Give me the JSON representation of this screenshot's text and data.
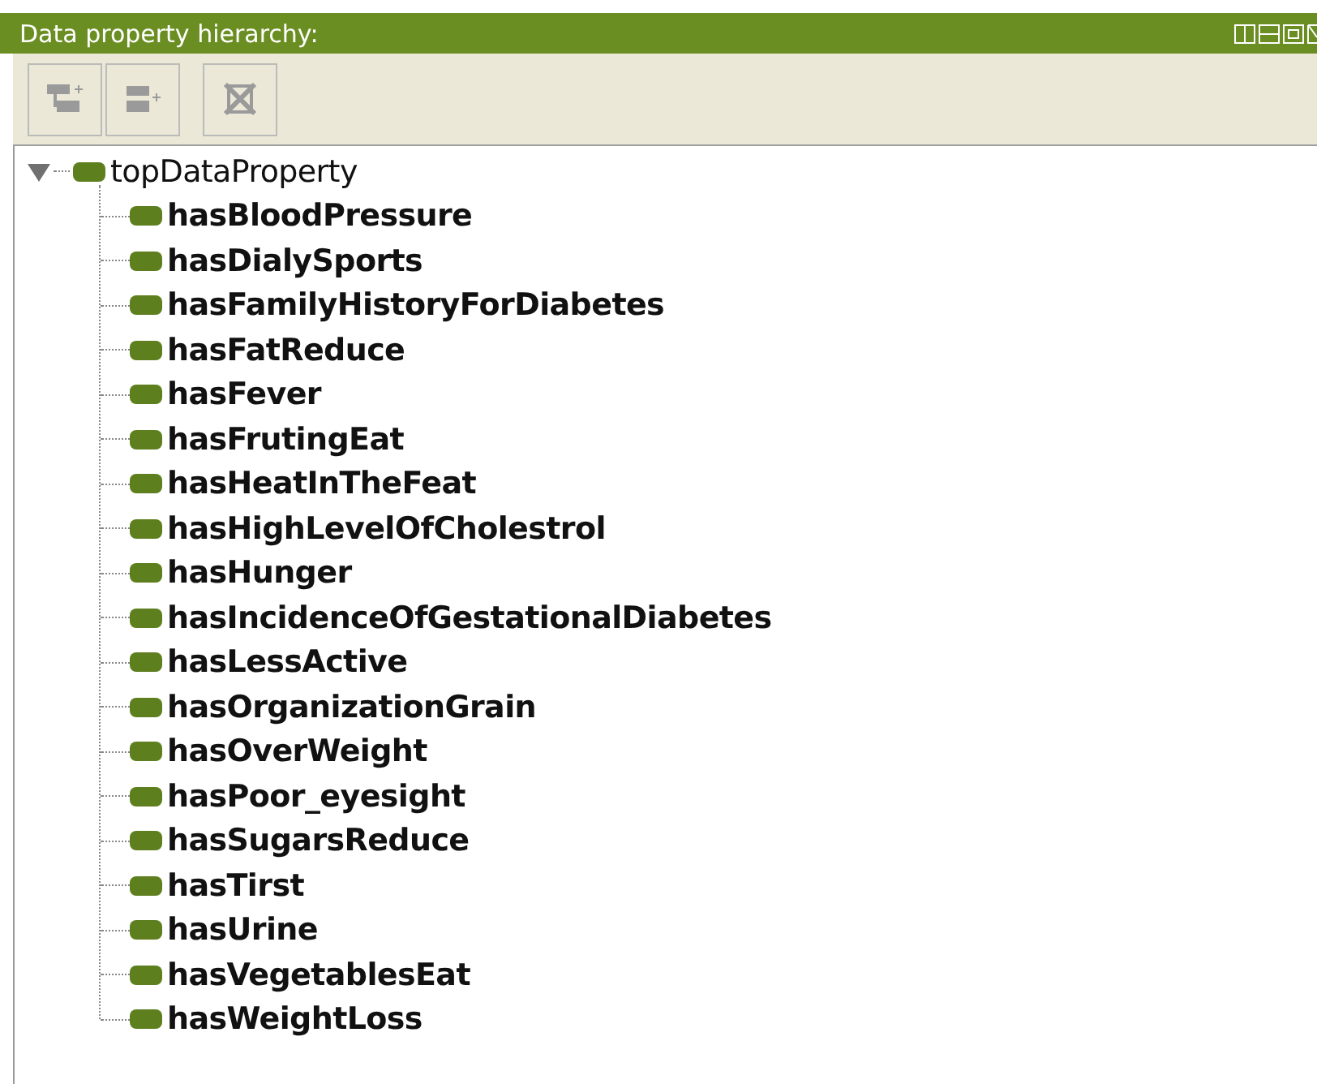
{
  "panel": {
    "title": "Data property hierarchy:"
  },
  "toolbar": [
    {
      "kind": "add-sub",
      "disabled": true
    },
    {
      "kind": "add-sibling",
      "disabled": true
    },
    {
      "kind": "delete",
      "disabled": true
    }
  ],
  "tree": [
    {
      "label": "topDataProperty",
      "expanded": true,
      "bold": false,
      "children": [
        {
          "label": "hasBloodPressure",
          "bold": true
        },
        {
          "label": "hasDialySports",
          "bold": true
        },
        {
          "label": "hasFamilyHistoryForDiabetes",
          "bold": true
        },
        {
          "label": "hasFatReduce",
          "bold": true
        },
        {
          "label": "hasFever",
          "bold": true
        },
        {
          "label": "hasFrutingEat",
          "bold": true
        },
        {
          "label": "hasHeatInTheFeat",
          "bold": true
        },
        {
          "label": "hasHighLevelOfCholestrol",
          "bold": true
        },
        {
          "label": "hasHunger",
          "bold": true
        },
        {
          "label": "hasIncidenceOfGestationalDiabetes",
          "bold": true
        },
        {
          "label": "hasLessActive",
          "bold": true
        },
        {
          "label": "hasOrganizationGrain",
          "bold": true
        },
        {
          "label": "hasOverWeight",
          "bold": true
        },
        {
          "label": "hasPoor_eyesight",
          "bold": true
        },
        {
          "label": "hasSugarsReduce",
          "bold": true
        },
        {
          "label": "hasTirst",
          "bold": true
        },
        {
          "label": "hasUrine",
          "bold": true
        },
        {
          "label": "hasVegetablesEat",
          "bold": true
        },
        {
          "label": "hasWeightLoss",
          "bold": true
        }
      ]
    }
  ]
}
